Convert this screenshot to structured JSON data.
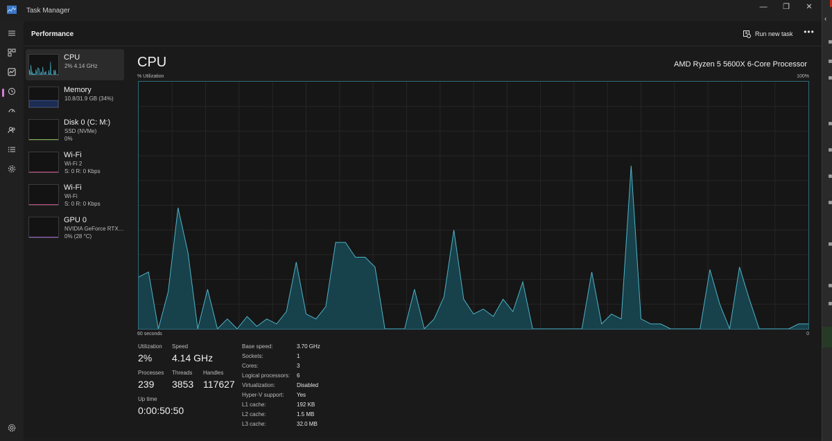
{
  "window": {
    "title": "Task Manager",
    "minimize_glyph": "—",
    "maximize_glyph": "❐",
    "close_glyph": "✕"
  },
  "nav": {
    "icons": [
      "hamburger-icon",
      "processes-icon",
      "performance-icon",
      "app-history-icon",
      "startup-apps-icon",
      "users-icon",
      "details-icon",
      "services-icon"
    ],
    "active": "performance-icon",
    "settings_icon": "gear-icon"
  },
  "header": {
    "title": "Performance",
    "run_new_task": "Run new task",
    "more_glyph": "•••"
  },
  "devices": [
    {
      "name": "CPU",
      "line1": "2%  4.14 GHz",
      "line2": "",
      "color": "#4fb3c8",
      "selected": true
    },
    {
      "name": "Memory",
      "line1": "10.8/31.9 GB (34%)",
      "line2": "",
      "color": "#4f74c8",
      "selected": false
    },
    {
      "name": "Disk 0 (C: M:)",
      "line1": "SSD (NVMe)",
      "line2": "0%",
      "color": "#7fb34f",
      "selected": false
    },
    {
      "name": "Wi-Fi",
      "line1": "Wi-Fi 2",
      "line2": "S: 0  R: 0 Kbps",
      "color": "#c84f8a",
      "selected": false
    },
    {
      "name": "Wi-Fi",
      "line1": "Wi-Fi",
      "line2": "S: 0  R: 0 Kbps",
      "color": "#c84f8a",
      "selected": false
    },
    {
      "name": "GPU 0",
      "line1": "NVIDIA GeForce RTX ...",
      "line2": "0%  (28 °C)",
      "color": "#9a5fc8",
      "selected": false
    }
  ],
  "cpu": {
    "title": "CPU",
    "processor": "AMD Ryzen 5 5600X 6-Core Processor",
    "axis_top_left": "% Utilization",
    "axis_top_right": "100%",
    "axis_bottom_left": "60 seconds",
    "axis_bottom_right": "0",
    "stats": {
      "utilization_label": "Utilization",
      "utilization_value": "2%",
      "speed_label": "Speed",
      "speed_value": "4.14 GHz",
      "processes_label": "Processes",
      "processes_value": "239",
      "threads_label": "Threads",
      "threads_value": "3853",
      "handles_label": "Handles",
      "handles_value": "117627",
      "uptime_label": "Up time",
      "uptime_value": "0:00:50:50"
    },
    "specs": [
      {
        "label": "Base speed:",
        "value": "3.70 GHz"
      },
      {
        "label": "Sockets:",
        "value": "1"
      },
      {
        "label": "Cores:",
        "value": "3"
      },
      {
        "label": "Logical processors:",
        "value": "6"
      },
      {
        "label": "Virtualization:",
        "value": "Disabled"
      },
      {
        "label": "Hyper-V support:",
        "value": "Yes"
      },
      {
        "label": "L1 cache:",
        "value": "192 KB"
      },
      {
        "label": "L2 cache:",
        "value": "1.5 MB"
      },
      {
        "label": "L3 cache:",
        "value": "32.0 MB"
      }
    ]
  },
  "chart_data": {
    "type": "area",
    "x_range_seconds": [
      60,
      0
    ],
    "ylim": [
      0,
      100
    ],
    "grid": true,
    "color": "#4fb3c8",
    "fill": "#17414b",
    "values": [
      21,
      23,
      0,
      15,
      49,
      31,
      0,
      16,
      0,
      4,
      0,
      5,
      1,
      4,
      2,
      7,
      27,
      6,
      4,
      9,
      35,
      35,
      29,
      29,
      25,
      0,
      0,
      0,
      16,
      0,
      4,
      13,
      40,
      12,
      6,
      8,
      5,
      12,
      7,
      19,
      0,
      0,
      0,
      0,
      0,
      0,
      23,
      2,
      6,
      4,
      66,
      4,
      2,
      2,
      0,
      0,
      0,
      0,
      24,
      10,
      0,
      25,
      12,
      0,
      0,
      0,
      0,
      2,
      2
    ]
  }
}
